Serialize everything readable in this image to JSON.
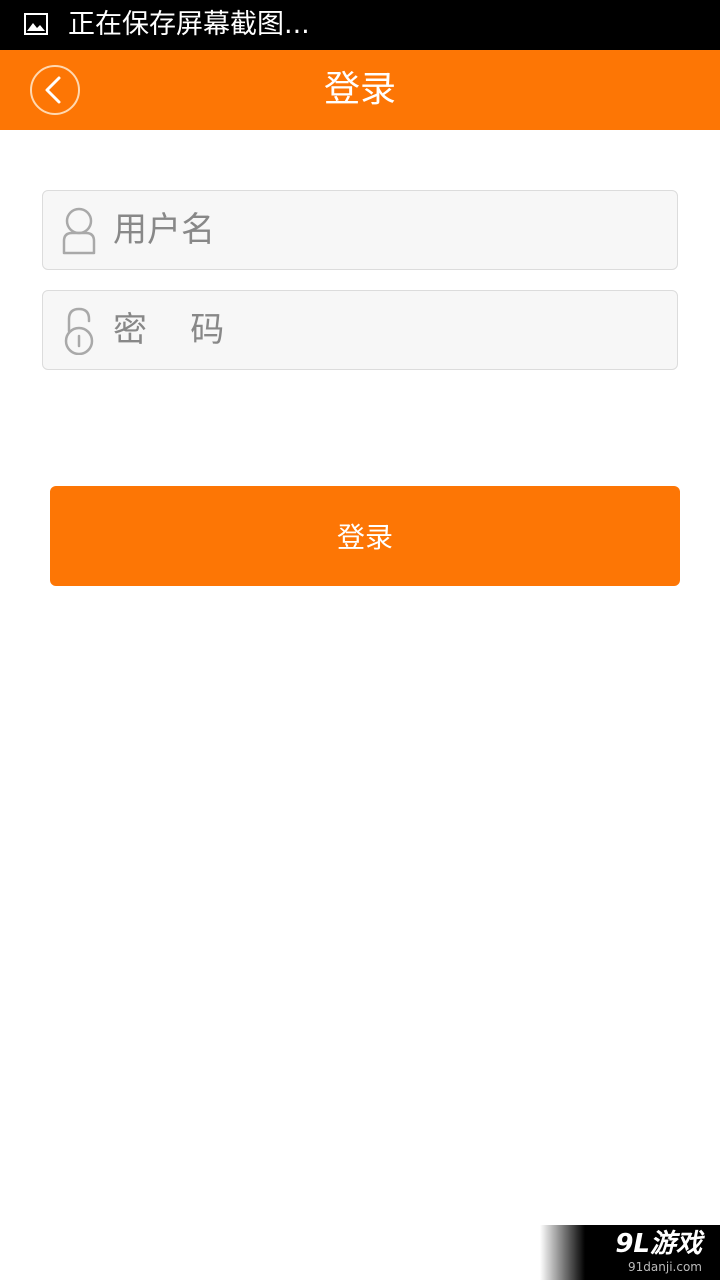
{
  "status_bar": {
    "icon": "image-icon",
    "text": "正在保存屏幕截图..."
  },
  "header": {
    "back_icon": "chevron-left-icon",
    "title": "登录"
  },
  "form": {
    "username": {
      "icon": "user-icon",
      "placeholder": "用户名",
      "value": ""
    },
    "password": {
      "icon": "unlock-icon",
      "placeholder": "密    码",
      "value": ""
    },
    "login_label": "登录"
  },
  "watermark": {
    "main": "9L游戏",
    "sub": "91danji.com"
  },
  "colors": {
    "accent": "#fd7605",
    "status_bar": "#000000",
    "field_bg": "#f7f7f7",
    "field_border": "#dcdcdc"
  }
}
